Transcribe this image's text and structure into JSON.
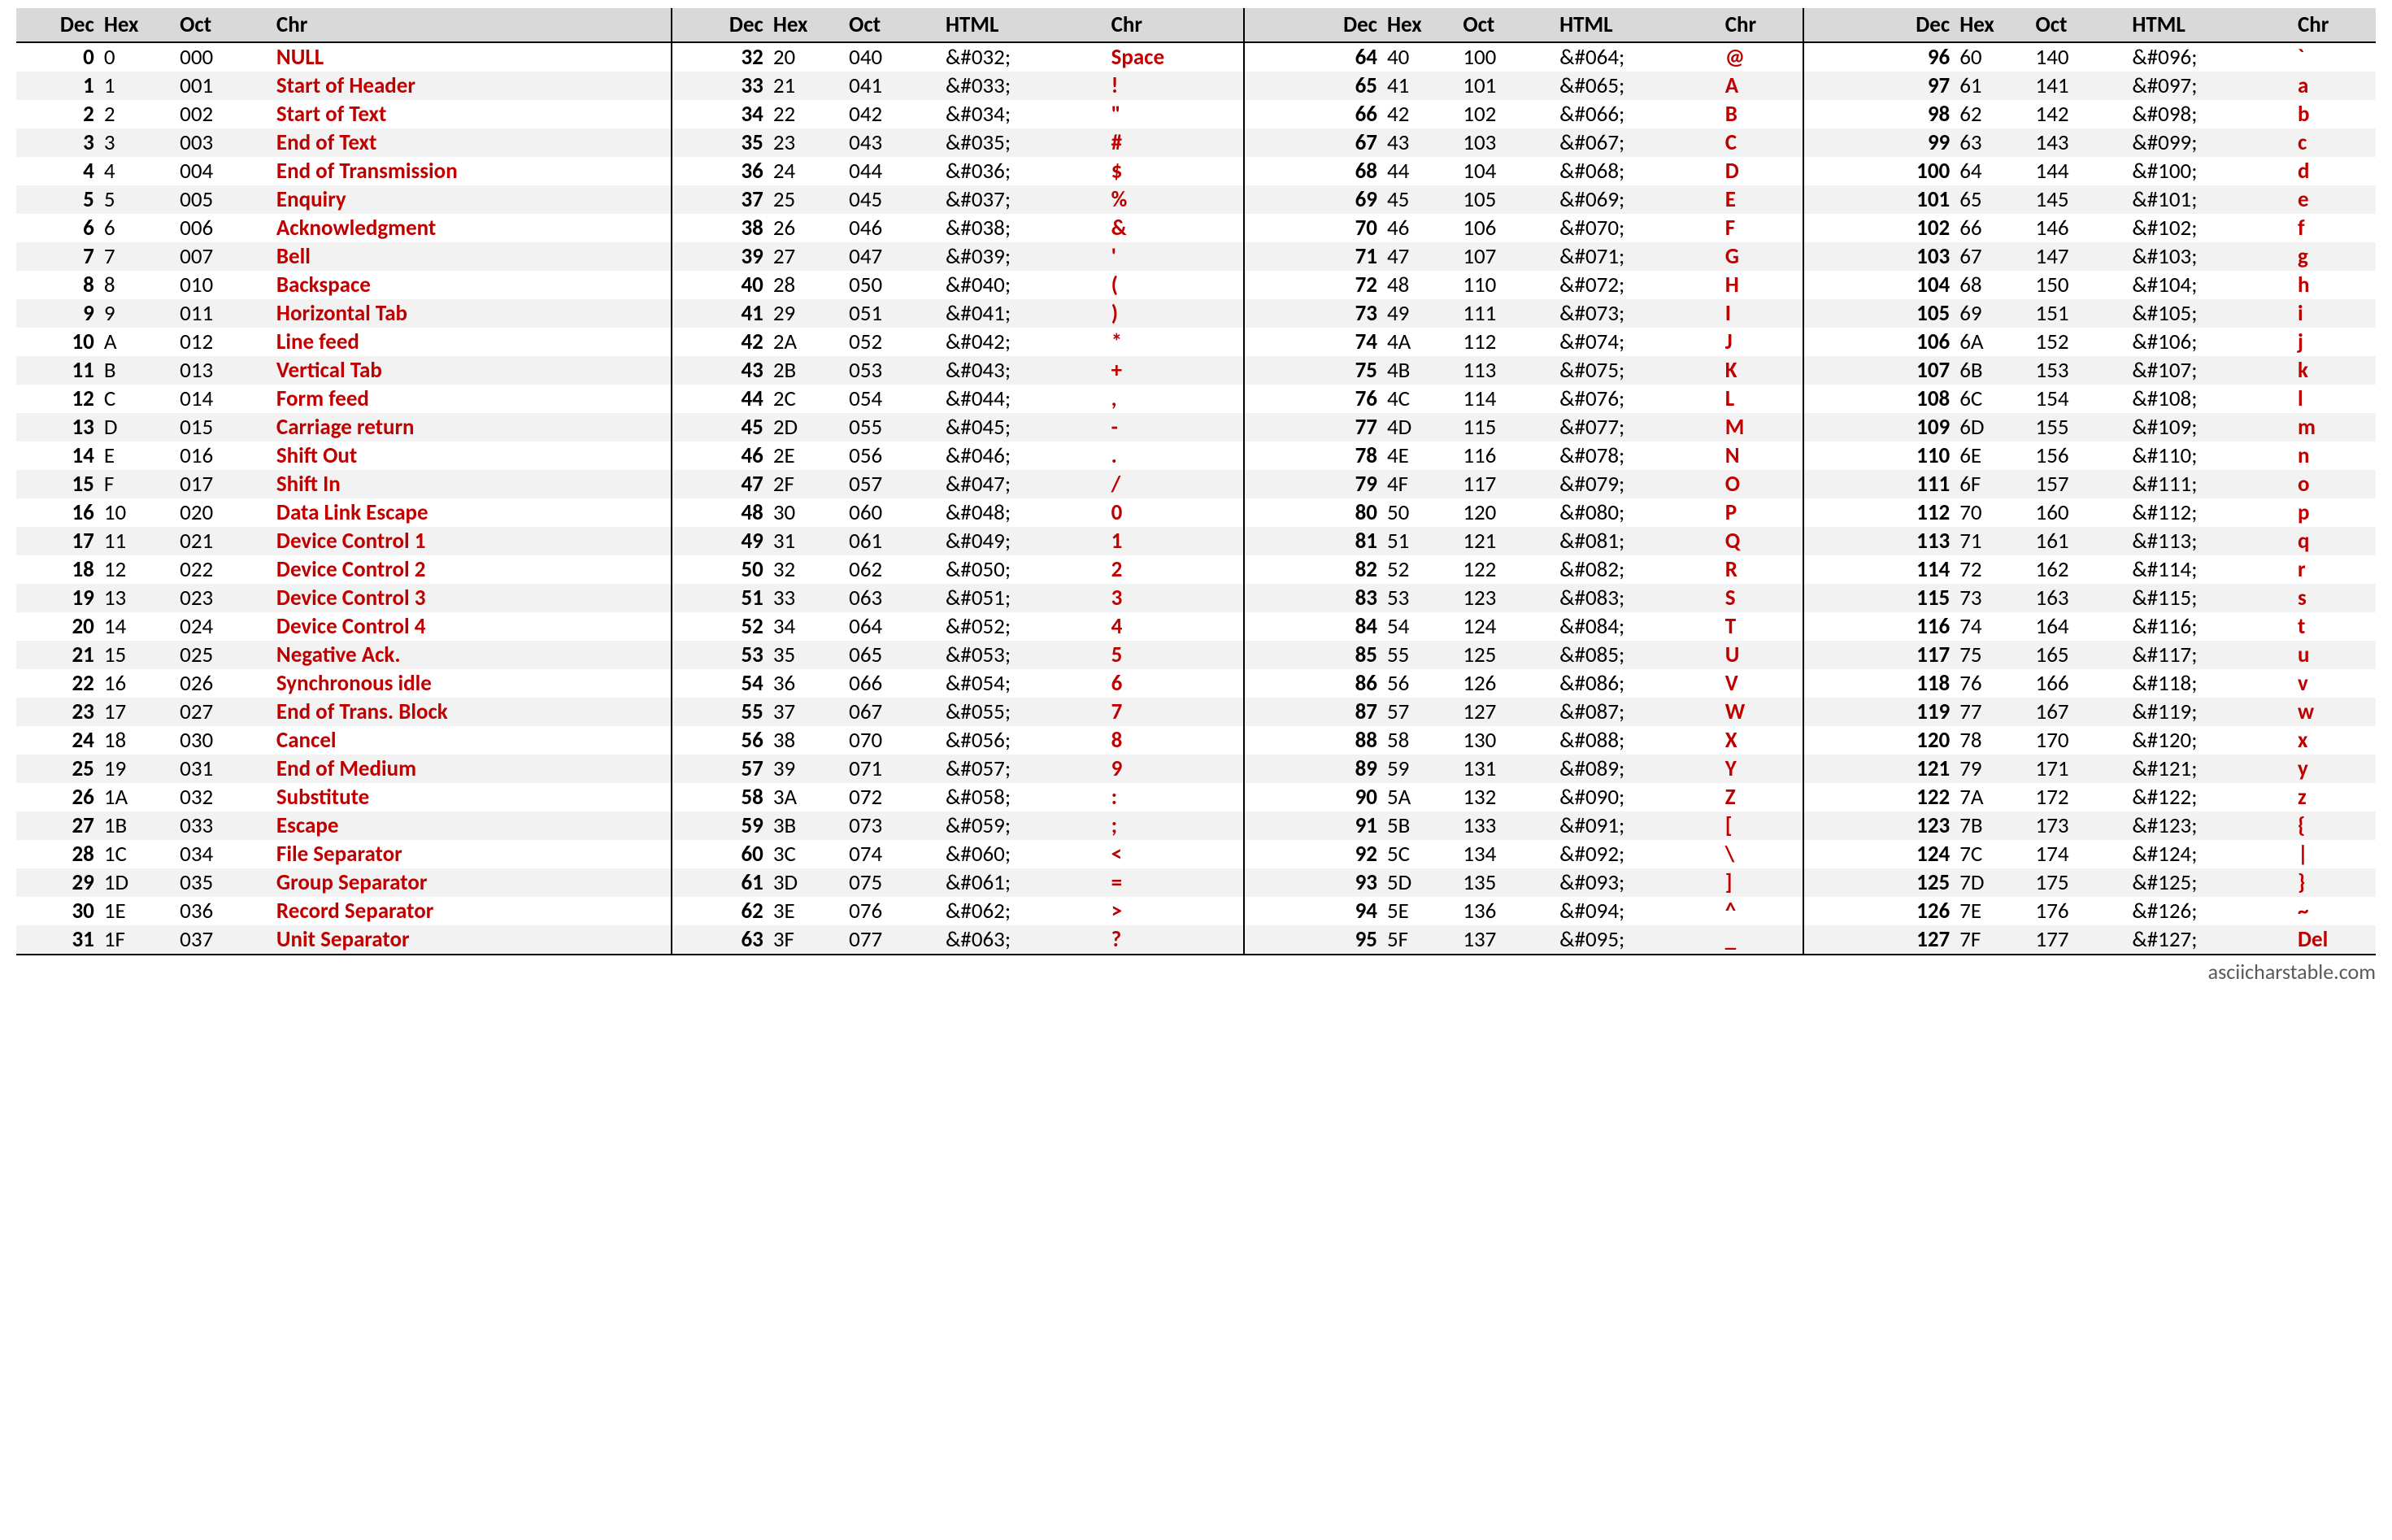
{
  "footer": "asciicharstable.com",
  "headers": {
    "dec": "Dec",
    "hex": "Hex",
    "oct": "Oct",
    "html": "HTML",
    "chr": "Chr"
  },
  "block0": [
    {
      "dec": "0",
      "hex": "0",
      "oct": "000",
      "chr": "NULL"
    },
    {
      "dec": "1",
      "hex": "1",
      "oct": "001",
      "chr": "Start of Header"
    },
    {
      "dec": "2",
      "hex": "2",
      "oct": "002",
      "chr": "Start of Text"
    },
    {
      "dec": "3",
      "hex": "3",
      "oct": "003",
      "chr": "End of Text"
    },
    {
      "dec": "4",
      "hex": "4",
      "oct": "004",
      "chr": "End of Transmission"
    },
    {
      "dec": "5",
      "hex": "5",
      "oct": "005",
      "chr": "Enquiry"
    },
    {
      "dec": "6",
      "hex": "6",
      "oct": "006",
      "chr": "Acknowledgment"
    },
    {
      "dec": "7",
      "hex": "7",
      "oct": "007",
      "chr": "Bell"
    },
    {
      "dec": "8",
      "hex": "8",
      "oct": "010",
      "chr": "Backspace"
    },
    {
      "dec": "9",
      "hex": "9",
      "oct": "011",
      "chr": "Horizontal Tab"
    },
    {
      "dec": "10",
      "hex": "A",
      "oct": "012",
      "chr": "Line feed"
    },
    {
      "dec": "11",
      "hex": "B",
      "oct": "013",
      "chr": "Vertical Tab"
    },
    {
      "dec": "12",
      "hex": "C",
      "oct": "014",
      "chr": "Form feed"
    },
    {
      "dec": "13",
      "hex": "D",
      "oct": "015",
      "chr": "Carriage return"
    },
    {
      "dec": "14",
      "hex": "E",
      "oct": "016",
      "chr": "Shift Out"
    },
    {
      "dec": "15",
      "hex": "F",
      "oct": "017",
      "chr": "Shift In"
    },
    {
      "dec": "16",
      "hex": "10",
      "oct": "020",
      "chr": "Data Link Escape"
    },
    {
      "dec": "17",
      "hex": "11",
      "oct": "021",
      "chr": "Device Control 1"
    },
    {
      "dec": "18",
      "hex": "12",
      "oct": "022",
      "chr": "Device Control 2"
    },
    {
      "dec": "19",
      "hex": "13",
      "oct": "023",
      "chr": "Device Control 3"
    },
    {
      "dec": "20",
      "hex": "14",
      "oct": "024",
      "chr": "Device Control 4"
    },
    {
      "dec": "21",
      "hex": "15",
      "oct": "025",
      "chr": "Negative Ack."
    },
    {
      "dec": "22",
      "hex": "16",
      "oct": "026",
      "chr": "Synchronous idle"
    },
    {
      "dec": "23",
      "hex": "17",
      "oct": "027",
      "chr": "End of Trans. Block"
    },
    {
      "dec": "24",
      "hex": "18",
      "oct": "030",
      "chr": "Cancel"
    },
    {
      "dec": "25",
      "hex": "19",
      "oct": "031",
      "chr": "End of Medium"
    },
    {
      "dec": "26",
      "hex": "1A",
      "oct": "032",
      "chr": "Substitute"
    },
    {
      "dec": "27",
      "hex": "1B",
      "oct": "033",
      "chr": "Escape"
    },
    {
      "dec": "28",
      "hex": "1C",
      "oct": "034",
      "chr": "File Separator"
    },
    {
      "dec": "29",
      "hex": "1D",
      "oct": "035",
      "chr": "Group Separator"
    },
    {
      "dec": "30",
      "hex": "1E",
      "oct": "036",
      "chr": "Record Separator"
    },
    {
      "dec": "31",
      "hex": "1F",
      "oct": "037",
      "chr": "Unit Separator"
    }
  ],
  "block1": [
    {
      "dec": "32",
      "hex": "20",
      "oct": "040",
      "html": "&#032;",
      "chr": "Space"
    },
    {
      "dec": "33",
      "hex": "21",
      "oct": "041",
      "html": "&#033;",
      "chr": "!"
    },
    {
      "dec": "34",
      "hex": "22",
      "oct": "042",
      "html": "&#034;",
      "chr": "\""
    },
    {
      "dec": "35",
      "hex": "23",
      "oct": "043",
      "html": "&#035;",
      "chr": "#"
    },
    {
      "dec": "36",
      "hex": "24",
      "oct": "044",
      "html": "&#036;",
      "chr": "$"
    },
    {
      "dec": "37",
      "hex": "25",
      "oct": "045",
      "html": "&#037;",
      "chr": "%"
    },
    {
      "dec": "38",
      "hex": "26",
      "oct": "046",
      "html": "&#038;",
      "chr": "&"
    },
    {
      "dec": "39",
      "hex": "27",
      "oct": "047",
      "html": "&#039;",
      "chr": "'"
    },
    {
      "dec": "40",
      "hex": "28",
      "oct": "050",
      "html": "&#040;",
      "chr": "("
    },
    {
      "dec": "41",
      "hex": "29",
      "oct": "051",
      "html": "&#041;",
      "chr": ")"
    },
    {
      "dec": "42",
      "hex": "2A",
      "oct": "052",
      "html": "&#042;",
      "chr": "*"
    },
    {
      "dec": "43",
      "hex": "2B",
      "oct": "053",
      "html": "&#043;",
      "chr": "+"
    },
    {
      "dec": "44",
      "hex": "2C",
      "oct": "054",
      "html": "&#044;",
      "chr": ","
    },
    {
      "dec": "45",
      "hex": "2D",
      "oct": "055",
      "html": "&#045;",
      "chr": "-"
    },
    {
      "dec": "46",
      "hex": "2E",
      "oct": "056",
      "html": "&#046;",
      "chr": "."
    },
    {
      "dec": "47",
      "hex": "2F",
      "oct": "057",
      "html": "&#047;",
      "chr": "/"
    },
    {
      "dec": "48",
      "hex": "30",
      "oct": "060",
      "html": "&#048;",
      "chr": "0"
    },
    {
      "dec": "49",
      "hex": "31",
      "oct": "061",
      "html": "&#049;",
      "chr": "1"
    },
    {
      "dec": "50",
      "hex": "32",
      "oct": "062",
      "html": "&#050;",
      "chr": "2"
    },
    {
      "dec": "51",
      "hex": "33",
      "oct": "063",
      "html": "&#051;",
      "chr": "3"
    },
    {
      "dec": "52",
      "hex": "34",
      "oct": "064",
      "html": "&#052;",
      "chr": "4"
    },
    {
      "dec": "53",
      "hex": "35",
      "oct": "065",
      "html": "&#053;",
      "chr": "5"
    },
    {
      "dec": "54",
      "hex": "36",
      "oct": "066",
      "html": "&#054;",
      "chr": "6"
    },
    {
      "dec": "55",
      "hex": "37",
      "oct": "067",
      "html": "&#055;",
      "chr": "7"
    },
    {
      "dec": "56",
      "hex": "38",
      "oct": "070",
      "html": "&#056;",
      "chr": "8"
    },
    {
      "dec": "57",
      "hex": "39",
      "oct": "071",
      "html": "&#057;",
      "chr": "9"
    },
    {
      "dec": "58",
      "hex": "3A",
      "oct": "072",
      "html": "&#058;",
      "chr": ":"
    },
    {
      "dec": "59",
      "hex": "3B",
      "oct": "073",
      "html": "&#059;",
      "chr": ";"
    },
    {
      "dec": "60",
      "hex": "3C",
      "oct": "074",
      "html": "&#060;",
      "chr": "<"
    },
    {
      "dec": "61",
      "hex": "3D",
      "oct": "075",
      "html": "&#061;",
      "chr": "="
    },
    {
      "dec": "62",
      "hex": "3E",
      "oct": "076",
      "html": "&#062;",
      "chr": ">"
    },
    {
      "dec": "63",
      "hex": "3F",
      "oct": "077",
      "html": "&#063;",
      "chr": "?"
    }
  ],
  "block2": [
    {
      "dec": "64",
      "hex": "40",
      "oct": "100",
      "html": "&#064;",
      "chr": "@"
    },
    {
      "dec": "65",
      "hex": "41",
      "oct": "101",
      "html": "&#065;",
      "chr": "A"
    },
    {
      "dec": "66",
      "hex": "42",
      "oct": "102",
      "html": "&#066;",
      "chr": "B"
    },
    {
      "dec": "67",
      "hex": "43",
      "oct": "103",
      "html": "&#067;",
      "chr": "C"
    },
    {
      "dec": "68",
      "hex": "44",
      "oct": "104",
      "html": "&#068;",
      "chr": "D"
    },
    {
      "dec": "69",
      "hex": "45",
      "oct": "105",
      "html": "&#069;",
      "chr": "E"
    },
    {
      "dec": "70",
      "hex": "46",
      "oct": "106",
      "html": "&#070;",
      "chr": "F"
    },
    {
      "dec": "71",
      "hex": "47",
      "oct": "107",
      "html": "&#071;",
      "chr": "G"
    },
    {
      "dec": "72",
      "hex": "48",
      "oct": "110",
      "html": "&#072;",
      "chr": "H"
    },
    {
      "dec": "73",
      "hex": "49",
      "oct": "111",
      "html": "&#073;",
      "chr": "I"
    },
    {
      "dec": "74",
      "hex": "4A",
      "oct": "112",
      "html": "&#074;",
      "chr": "J"
    },
    {
      "dec": "75",
      "hex": "4B",
      "oct": "113",
      "html": "&#075;",
      "chr": "K"
    },
    {
      "dec": "76",
      "hex": "4C",
      "oct": "114",
      "html": "&#076;",
      "chr": "L"
    },
    {
      "dec": "77",
      "hex": "4D",
      "oct": "115",
      "html": "&#077;",
      "chr": "M"
    },
    {
      "dec": "78",
      "hex": "4E",
      "oct": "116",
      "html": "&#078;",
      "chr": "N"
    },
    {
      "dec": "79",
      "hex": "4F",
      "oct": "117",
      "html": "&#079;",
      "chr": "O"
    },
    {
      "dec": "80",
      "hex": "50",
      "oct": "120",
      "html": "&#080;",
      "chr": "P"
    },
    {
      "dec": "81",
      "hex": "51",
      "oct": "121",
      "html": "&#081;",
      "chr": "Q"
    },
    {
      "dec": "82",
      "hex": "52",
      "oct": "122",
      "html": "&#082;",
      "chr": "R"
    },
    {
      "dec": "83",
      "hex": "53",
      "oct": "123",
      "html": "&#083;",
      "chr": "S"
    },
    {
      "dec": "84",
      "hex": "54",
      "oct": "124",
      "html": "&#084;",
      "chr": "T"
    },
    {
      "dec": "85",
      "hex": "55",
      "oct": "125",
      "html": "&#085;",
      "chr": "U"
    },
    {
      "dec": "86",
      "hex": "56",
      "oct": "126",
      "html": "&#086;",
      "chr": "V"
    },
    {
      "dec": "87",
      "hex": "57",
      "oct": "127",
      "html": "&#087;",
      "chr": "W"
    },
    {
      "dec": "88",
      "hex": "58",
      "oct": "130",
      "html": "&#088;",
      "chr": "X"
    },
    {
      "dec": "89",
      "hex": "59",
      "oct": "131",
      "html": "&#089;",
      "chr": "Y"
    },
    {
      "dec": "90",
      "hex": "5A",
      "oct": "132",
      "html": "&#090;",
      "chr": "Z"
    },
    {
      "dec": "91",
      "hex": "5B",
      "oct": "133",
      "html": "&#091;",
      "chr": "["
    },
    {
      "dec": "92",
      "hex": "5C",
      "oct": "134",
      "html": "&#092;",
      "chr": "\\"
    },
    {
      "dec": "93",
      "hex": "5D",
      "oct": "135",
      "html": "&#093;",
      "chr": "]"
    },
    {
      "dec": "94",
      "hex": "5E",
      "oct": "136",
      "html": "&#094;",
      "chr": "^"
    },
    {
      "dec": "95",
      "hex": "5F",
      "oct": "137",
      "html": "&#095;",
      "chr": "_"
    }
  ],
  "block3": [
    {
      "dec": "96",
      "hex": "60",
      "oct": "140",
      "html": "&#096;",
      "chr": "`"
    },
    {
      "dec": "97",
      "hex": "61",
      "oct": "141",
      "html": "&#097;",
      "chr": "a"
    },
    {
      "dec": "98",
      "hex": "62",
      "oct": "142",
      "html": "&#098;",
      "chr": "b"
    },
    {
      "dec": "99",
      "hex": "63",
      "oct": "143",
      "html": "&#099;",
      "chr": "c"
    },
    {
      "dec": "100",
      "hex": "64",
      "oct": "144",
      "html": "&#100;",
      "chr": "d"
    },
    {
      "dec": "101",
      "hex": "65",
      "oct": "145",
      "html": "&#101;",
      "chr": "e"
    },
    {
      "dec": "102",
      "hex": "66",
      "oct": "146",
      "html": "&#102;",
      "chr": "f"
    },
    {
      "dec": "103",
      "hex": "67",
      "oct": "147",
      "html": "&#103;",
      "chr": "g"
    },
    {
      "dec": "104",
      "hex": "68",
      "oct": "150",
      "html": "&#104;",
      "chr": "h"
    },
    {
      "dec": "105",
      "hex": "69",
      "oct": "151",
      "html": "&#105;",
      "chr": "i"
    },
    {
      "dec": "106",
      "hex": "6A",
      "oct": "152",
      "html": "&#106;",
      "chr": "j"
    },
    {
      "dec": "107",
      "hex": "6B",
      "oct": "153",
      "html": "&#107;",
      "chr": "k"
    },
    {
      "dec": "108",
      "hex": "6C",
      "oct": "154",
      "html": "&#108;",
      "chr": "l"
    },
    {
      "dec": "109",
      "hex": "6D",
      "oct": "155",
      "html": "&#109;",
      "chr": "m"
    },
    {
      "dec": "110",
      "hex": "6E",
      "oct": "156",
      "html": "&#110;",
      "chr": "n"
    },
    {
      "dec": "111",
      "hex": "6F",
      "oct": "157",
      "html": "&#111;",
      "chr": "o"
    },
    {
      "dec": "112",
      "hex": "70",
      "oct": "160",
      "html": "&#112;",
      "chr": "p"
    },
    {
      "dec": "113",
      "hex": "71",
      "oct": "161",
      "html": "&#113;",
      "chr": "q"
    },
    {
      "dec": "114",
      "hex": "72",
      "oct": "162",
      "html": "&#114;",
      "chr": "r"
    },
    {
      "dec": "115",
      "hex": "73",
      "oct": "163",
      "html": "&#115;",
      "chr": "s"
    },
    {
      "dec": "116",
      "hex": "74",
      "oct": "164",
      "html": "&#116;",
      "chr": "t"
    },
    {
      "dec": "117",
      "hex": "75",
      "oct": "165",
      "html": "&#117;",
      "chr": "u"
    },
    {
      "dec": "118",
      "hex": "76",
      "oct": "166",
      "html": "&#118;",
      "chr": "v"
    },
    {
      "dec": "119",
      "hex": "77",
      "oct": "167",
      "html": "&#119;",
      "chr": "w"
    },
    {
      "dec": "120",
      "hex": "78",
      "oct": "170",
      "html": "&#120;",
      "chr": "x"
    },
    {
      "dec": "121",
      "hex": "79",
      "oct": "171",
      "html": "&#121;",
      "chr": "y"
    },
    {
      "dec": "122",
      "hex": "7A",
      "oct": "172",
      "html": "&#122;",
      "chr": "z"
    },
    {
      "dec": "123",
      "hex": "7B",
      "oct": "173",
      "html": "&#123;",
      "chr": "{"
    },
    {
      "dec": "124",
      "hex": "7C",
      "oct": "174",
      "html": "&#124;",
      "chr": "|"
    },
    {
      "dec": "125",
      "hex": "7D",
      "oct": "175",
      "html": "&#125;",
      "chr": "}"
    },
    {
      "dec": "126",
      "hex": "7E",
      "oct": "176",
      "html": "&#126;",
      "chr": "~"
    },
    {
      "dec": "127",
      "hex": "7F",
      "oct": "177",
      "html": "&#127;",
      "chr": "Del"
    }
  ]
}
